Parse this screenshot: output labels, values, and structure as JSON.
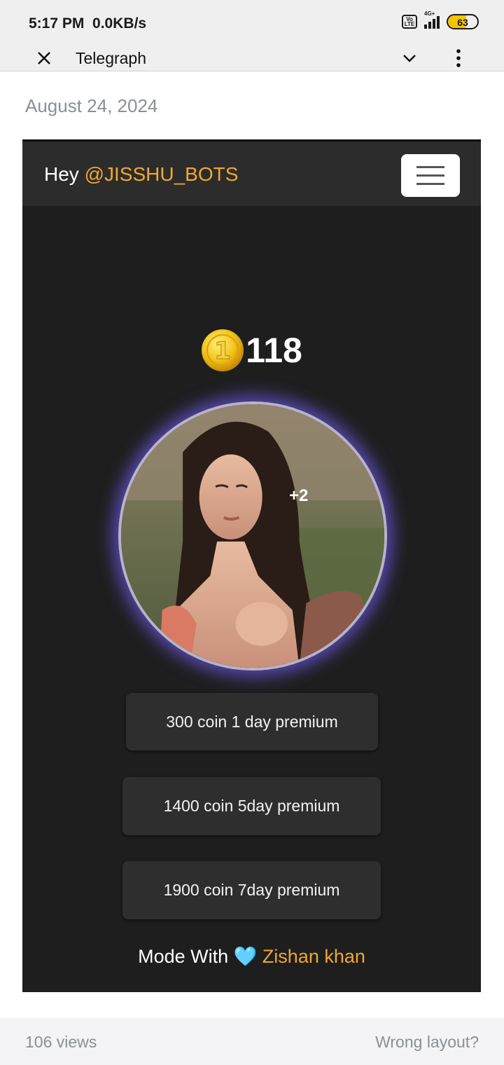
{
  "status_bar": {
    "time": "5:17 PM",
    "speed": "0.0KB/s",
    "volte": "Vo LTE",
    "network": "4G+",
    "battery": "63",
    "battery_level": 0.63
  },
  "browser": {
    "title": "Telegraph"
  },
  "article": {
    "date": "August 24, 2024"
  },
  "card": {
    "greeting_prefix": "Hey ",
    "username": "@JISSHU_BOTS",
    "coin_count": "118",
    "plus_badge": "+2",
    "plans": [
      "300 coin 1 day premium",
      "1400 coin 5day premium",
      "1900 coin 7day premium"
    ],
    "credit_prefix": "Mode With ",
    "credit_heart": "🩵",
    "credit_author": "Zishan khan"
  },
  "footer": {
    "views": "106 views",
    "wrong_layout": "Wrong layout?"
  },
  "colors": {
    "accent": "#f0a830",
    "card_bg": "#1e1e1e",
    "glow": "#6e5ae6"
  }
}
